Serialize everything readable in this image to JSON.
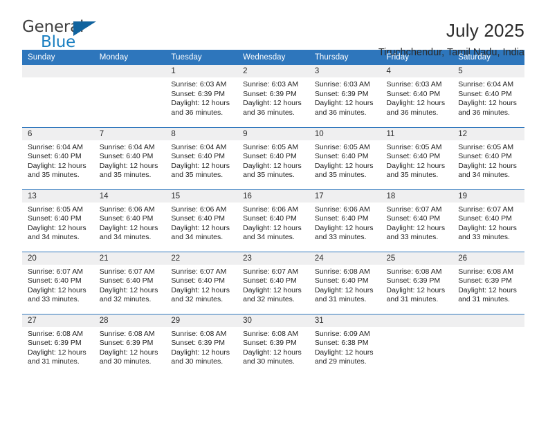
{
  "brand": {
    "name_top": "General",
    "name_bottom": "Blue",
    "flag_icon": "triangle-flag-icon",
    "color_top": "#3f3f3f",
    "color_bottom": "#1a7fc1",
    "flag_color": "#11639e"
  },
  "header": {
    "title": "July 2025",
    "subtitle": "Tiruchchendur, Tamil Nadu, India"
  },
  "theme": {
    "header_bg": "#2e76bc",
    "header_text": "#ffffff",
    "daynum_bg": "#efeff0",
    "cell_bg": "#ffffff",
    "row_divider": "#2e76bc"
  },
  "calendar": {
    "weekday_headers": [
      "Sunday",
      "Monday",
      "Tuesday",
      "Wednesday",
      "Thursday",
      "Friday",
      "Saturday"
    ],
    "weeks": [
      [
        {
          "day": "",
          "lines": []
        },
        {
          "day": "",
          "lines": []
        },
        {
          "day": "1",
          "lines": [
            "Sunrise: 6:03 AM",
            "Sunset: 6:39 PM",
            "Daylight: 12 hours",
            "and 36 minutes."
          ]
        },
        {
          "day": "2",
          "lines": [
            "Sunrise: 6:03 AM",
            "Sunset: 6:39 PM",
            "Daylight: 12 hours",
            "and 36 minutes."
          ]
        },
        {
          "day": "3",
          "lines": [
            "Sunrise: 6:03 AM",
            "Sunset: 6:39 PM",
            "Daylight: 12 hours",
            "and 36 minutes."
          ]
        },
        {
          "day": "4",
          "lines": [
            "Sunrise: 6:03 AM",
            "Sunset: 6:40 PM",
            "Daylight: 12 hours",
            "and 36 minutes."
          ]
        },
        {
          "day": "5",
          "lines": [
            "Sunrise: 6:04 AM",
            "Sunset: 6:40 PM",
            "Daylight: 12 hours",
            "and 36 minutes."
          ]
        }
      ],
      [
        {
          "day": "6",
          "lines": [
            "Sunrise: 6:04 AM",
            "Sunset: 6:40 PM",
            "Daylight: 12 hours",
            "and 35 minutes."
          ]
        },
        {
          "day": "7",
          "lines": [
            "Sunrise: 6:04 AM",
            "Sunset: 6:40 PM",
            "Daylight: 12 hours",
            "and 35 minutes."
          ]
        },
        {
          "day": "8",
          "lines": [
            "Sunrise: 6:04 AM",
            "Sunset: 6:40 PM",
            "Daylight: 12 hours",
            "and 35 minutes."
          ]
        },
        {
          "day": "9",
          "lines": [
            "Sunrise: 6:05 AM",
            "Sunset: 6:40 PM",
            "Daylight: 12 hours",
            "and 35 minutes."
          ]
        },
        {
          "day": "10",
          "lines": [
            "Sunrise: 6:05 AM",
            "Sunset: 6:40 PM",
            "Daylight: 12 hours",
            "and 35 minutes."
          ]
        },
        {
          "day": "11",
          "lines": [
            "Sunrise: 6:05 AM",
            "Sunset: 6:40 PM",
            "Daylight: 12 hours",
            "and 35 minutes."
          ]
        },
        {
          "day": "12",
          "lines": [
            "Sunrise: 6:05 AM",
            "Sunset: 6:40 PM",
            "Daylight: 12 hours",
            "and 34 minutes."
          ]
        }
      ],
      [
        {
          "day": "13",
          "lines": [
            "Sunrise: 6:05 AM",
            "Sunset: 6:40 PM",
            "Daylight: 12 hours",
            "and 34 minutes."
          ]
        },
        {
          "day": "14",
          "lines": [
            "Sunrise: 6:06 AM",
            "Sunset: 6:40 PM",
            "Daylight: 12 hours",
            "and 34 minutes."
          ]
        },
        {
          "day": "15",
          "lines": [
            "Sunrise: 6:06 AM",
            "Sunset: 6:40 PM",
            "Daylight: 12 hours",
            "and 34 minutes."
          ]
        },
        {
          "day": "16",
          "lines": [
            "Sunrise: 6:06 AM",
            "Sunset: 6:40 PM",
            "Daylight: 12 hours",
            "and 34 minutes."
          ]
        },
        {
          "day": "17",
          "lines": [
            "Sunrise: 6:06 AM",
            "Sunset: 6:40 PM",
            "Daylight: 12 hours",
            "and 33 minutes."
          ]
        },
        {
          "day": "18",
          "lines": [
            "Sunrise: 6:07 AM",
            "Sunset: 6:40 PM",
            "Daylight: 12 hours",
            "and 33 minutes."
          ]
        },
        {
          "day": "19",
          "lines": [
            "Sunrise: 6:07 AM",
            "Sunset: 6:40 PM",
            "Daylight: 12 hours",
            "and 33 minutes."
          ]
        }
      ],
      [
        {
          "day": "20",
          "lines": [
            "Sunrise: 6:07 AM",
            "Sunset: 6:40 PM",
            "Daylight: 12 hours",
            "and 33 minutes."
          ]
        },
        {
          "day": "21",
          "lines": [
            "Sunrise: 6:07 AM",
            "Sunset: 6:40 PM",
            "Daylight: 12 hours",
            "and 32 minutes."
          ]
        },
        {
          "day": "22",
          "lines": [
            "Sunrise: 6:07 AM",
            "Sunset: 6:40 PM",
            "Daylight: 12 hours",
            "and 32 minutes."
          ]
        },
        {
          "day": "23",
          "lines": [
            "Sunrise: 6:07 AM",
            "Sunset: 6:40 PM",
            "Daylight: 12 hours",
            "and 32 minutes."
          ]
        },
        {
          "day": "24",
          "lines": [
            "Sunrise: 6:08 AM",
            "Sunset: 6:40 PM",
            "Daylight: 12 hours",
            "and 31 minutes."
          ]
        },
        {
          "day": "25",
          "lines": [
            "Sunrise: 6:08 AM",
            "Sunset: 6:39 PM",
            "Daylight: 12 hours",
            "and 31 minutes."
          ]
        },
        {
          "day": "26",
          "lines": [
            "Sunrise: 6:08 AM",
            "Sunset: 6:39 PM",
            "Daylight: 12 hours",
            "and 31 minutes."
          ]
        }
      ],
      [
        {
          "day": "27",
          "lines": [
            "Sunrise: 6:08 AM",
            "Sunset: 6:39 PM",
            "Daylight: 12 hours",
            "and 31 minutes."
          ]
        },
        {
          "day": "28",
          "lines": [
            "Sunrise: 6:08 AM",
            "Sunset: 6:39 PM",
            "Daylight: 12 hours",
            "and 30 minutes."
          ]
        },
        {
          "day": "29",
          "lines": [
            "Sunrise: 6:08 AM",
            "Sunset: 6:39 PM",
            "Daylight: 12 hours",
            "and 30 minutes."
          ]
        },
        {
          "day": "30",
          "lines": [
            "Sunrise: 6:08 AM",
            "Sunset: 6:39 PM",
            "Daylight: 12 hours",
            "and 30 minutes."
          ]
        },
        {
          "day": "31",
          "lines": [
            "Sunrise: 6:09 AM",
            "Sunset: 6:38 PM",
            "Daylight: 12 hours",
            "and 29 minutes."
          ]
        },
        {
          "day": "",
          "lines": []
        },
        {
          "day": "",
          "lines": []
        }
      ]
    ]
  }
}
